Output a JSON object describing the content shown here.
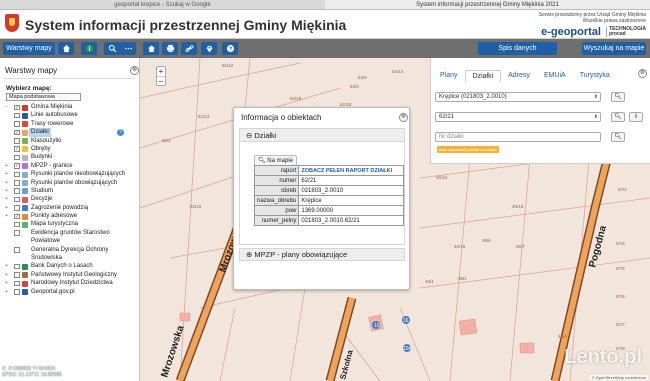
{
  "browser_tabs": [
    "geoportal krepice - Szukaj w Google",
    "System informacji przestrzennej Gminy Miękinia 2021"
  ],
  "header": {
    "title": "System informacji przestrzennej Gminy Miękinia",
    "subtitle_line1": "Serwis prowadzony przez Urząd Gminy Miękinia",
    "subtitle_line2": "Wszelkie prawa zastrzeżone",
    "brand": "e-geoportal",
    "badge_line1": "TECHNOLOGIA",
    "badge_line2": "procad"
  },
  "toolbar": {
    "layers_button": "Warstwy mapy",
    "icons": [
      "home-icon",
      "info-icon",
      "search-icon",
      "more-icon",
      "house-icon",
      "print-icon",
      "link-icon",
      "location-icon",
      "help-icon"
    ],
    "parcel_list_button": "Spis danych przestrzennych",
    "find_button": "Wyszukaj na mapie"
  },
  "layers_panel": {
    "title": "Warstwy mapy",
    "choose_label": "Wybierz mapę:",
    "basemap": "Mapa podstawowa",
    "items": [
      {
        "label": "Gmina Miękinia",
        "expand": "−",
        "checked": "✓",
        "color": "#d23b2a"
      },
      {
        "label": "Linie autobusowe",
        "expand": "",
        "checked": "",
        "color": "#1f5fa3"
      },
      {
        "label": "Trasy rowerowe",
        "expand": "",
        "checked": "",
        "color": "#e0463a"
      },
      {
        "label": "Działki",
        "expand": "",
        "checked": "✓",
        "color": "#f0a35e",
        "selected": true
      },
      {
        "label": "Klasoużytki",
        "expand": "",
        "checked": "",
        "color": "#7fb24f"
      },
      {
        "label": "Obręby",
        "expand": "",
        "checked": "✓",
        "color": "#e7c83d"
      },
      {
        "label": "Budynki",
        "expand": "",
        "checked": "",
        "color": "#b7b7b7"
      },
      {
        "label": "MPZP - granice",
        "expand": "+",
        "checked": "✓",
        "color": "#b46fcf"
      },
      {
        "label": "Rysunki planów nieobowiązujących",
        "expand": "+",
        "checked": "",
        "color": "#8fa9c9"
      },
      {
        "label": "Rysunki planów obowiązujących",
        "expand": "+",
        "checked": "",
        "color": "#8fa9c9"
      },
      {
        "label": "Studium",
        "expand": "+",
        "checked": "",
        "color": "#6aa0d4"
      },
      {
        "label": "Decyzje",
        "expand": "+",
        "checked": "",
        "color": "#e45a5a"
      },
      {
        "label": "Zagrożenie powodzią",
        "expand": "+",
        "checked": "",
        "color": "#3c7ed6"
      },
      {
        "label": "Punkty adresowe",
        "expand": "+",
        "checked": "✓",
        "color": "#e7863d"
      },
      {
        "label": "Mapa turystyczna",
        "expand": "",
        "checked": "",
        "color": "#5ab36b"
      },
      {
        "label": "Ewidencja gruntów Starostwo",
        "expand": "",
        "checked": "",
        "color": ""
      },
      {
        "label": "Powiatowe",
        "expand": "",
        "checked": "",
        "color": "",
        "continuation": true
      },
      {
        "label": "Generalna Dyrekcja Ochrony",
        "expand": "",
        "checked": "",
        "color": ""
      },
      {
        "label": "Środowiska",
        "expand": "",
        "checked": "",
        "color": "",
        "continuation": true
      },
      {
        "label": "Bank Danych o Lasach",
        "expand": "+",
        "checked": "",
        "color": "#2e8b57"
      },
      {
        "label": "Państwowy Instytut Geologiczny",
        "expand": "+",
        "checked": "",
        "color": "#a06f3c"
      },
      {
        "label": "Narodowy Instytut Dziedzictwa",
        "expand": "+",
        "checked": "",
        "color": "#c44"
      },
      {
        "label": "Geoportal.gov.pl",
        "expand": "+",
        "checked": "",
        "color": "#1f5fa3"
      }
    ],
    "help_glyph": "?",
    "close_glyph": "⊗",
    "coords_line1": "X: X=369833 Y=344834",
    "coords_line2": "EPSG: 51.13721 16.80985"
  },
  "info_popup": {
    "title": "Informacja o obiektach",
    "close_glyph": "⊗",
    "section_parcels": "Działki",
    "on_map_button": "Na mapie",
    "rows": [
      {
        "key": "raport",
        "value": "ZOBACZ PEŁEN RAPORT DZIAŁKI",
        "link": true
      },
      {
        "key": "numer",
        "value": "62/21"
      },
      {
        "key": "obreb",
        "value": "021803_2.0010"
      },
      {
        "key": "nazwa_obrebu",
        "value": "Krępice"
      },
      {
        "key": "pow",
        "value": "1369.00000"
      },
      {
        "key": "numer_pelny",
        "value": "021803_2.0010.62/21"
      }
    ],
    "section_mpzp": "MPZP - plany obowiązujące"
  },
  "search_panel": {
    "tabs": [
      "Plany",
      "Działki",
      "Adresy",
      "EMUiA",
      "Turystyka"
    ],
    "active_tab": "Działki",
    "precinct": "Krępice (021803_2.0010)",
    "parcel": "62/21",
    "parcel_placeholder": "Nr działki",
    "hint": "Brak wskazanej działki na mapie",
    "close_glyph": "⊗"
  },
  "map": {
    "street_labels": [
      "Mrozowska",
      "Mrozowska",
      "Pogodna",
      "Szkolna"
    ],
    "parcel_labels": [
      "62/12",
      "62/8",
      "62/9",
      "62/10",
      "62/19",
      "62/13",
      "62/1",
      "62/5",
      "62/20",
      "62/15",
      "46/24",
      "46/6",
      "46/7",
      "46/15",
      "46/16",
      "46/1",
      "38/1",
      "57/1",
      "57/2",
      "57/4",
      "57/5",
      "57/6",
      "57/7",
      "57/8",
      "45/4",
      "62/22"
    ],
    "house_numbers": [
      "10",
      "16",
      "10A"
    ],
    "zoom_in": "+",
    "zoom_out": "−"
  },
  "watermark": "Lento.pl",
  "attribution": "© OpenStreetMap contributors"
}
